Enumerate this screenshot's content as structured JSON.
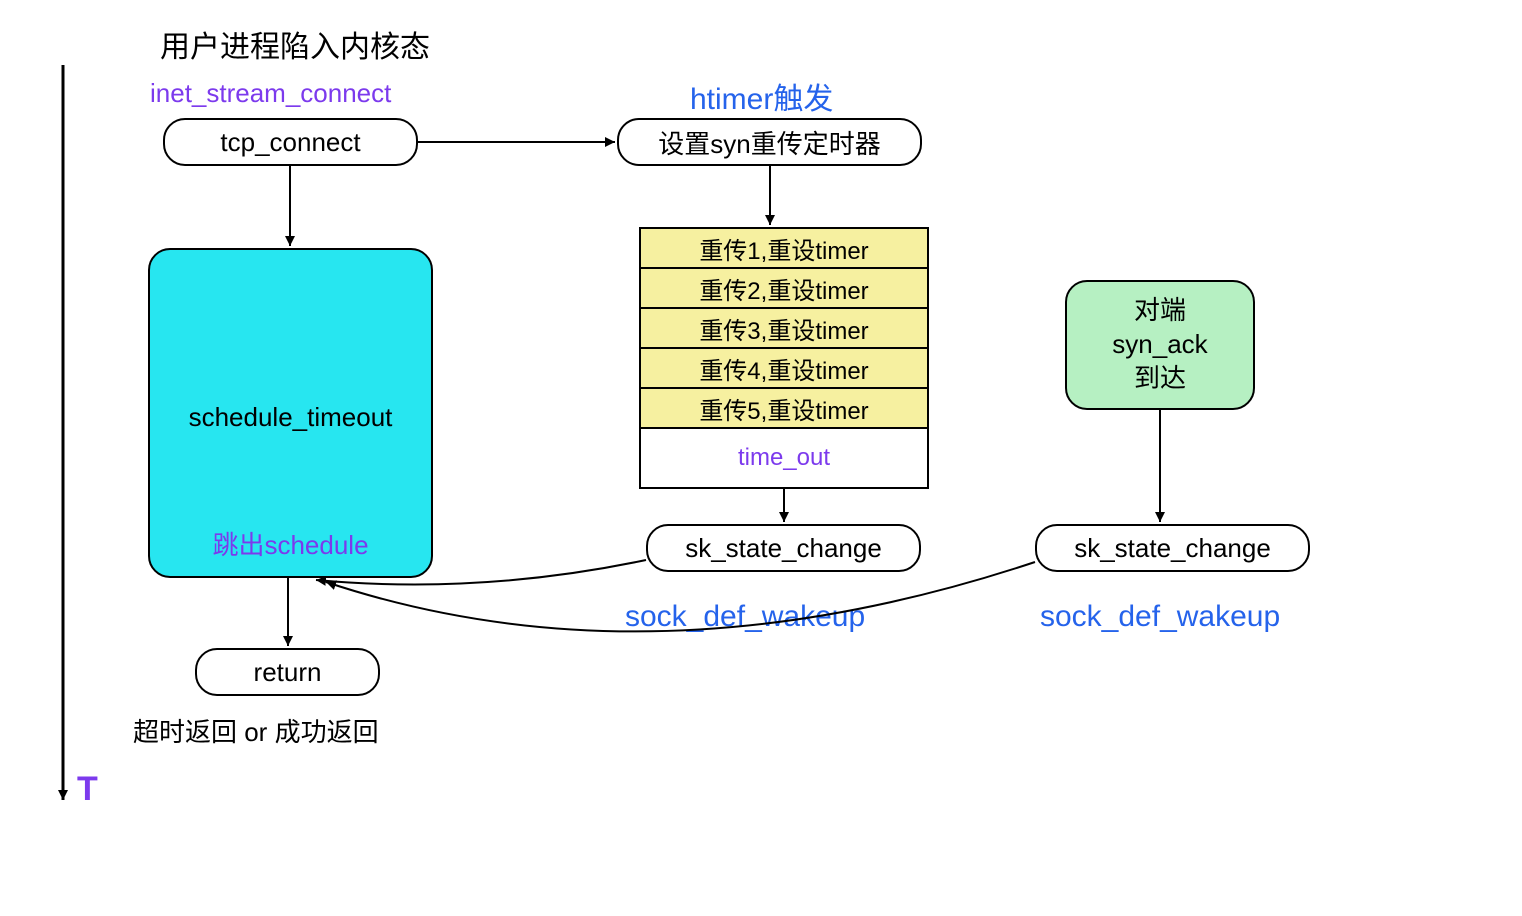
{
  "title": "用户进程陷入内核态",
  "labels": {
    "inet_stream_connect": "inet_stream_connect",
    "htimer": "htimer触发",
    "sock_def_wakeup_1": "sock_def_wakeup",
    "sock_def_wakeup_2": "sock_def_wakeup",
    "return_note": "超时返回 or 成功返回",
    "time_axis": "T",
    "jump_out_schedule": "跳出schedule"
  },
  "nodes": {
    "tcp_connect": "tcp_connect",
    "set_syn_timer": "设置syn重传定时器",
    "schedule_timeout": "schedule_timeout",
    "sk_state_change_1": "sk_state_change",
    "sk_state_change_2": "sk_state_change",
    "return": "return",
    "peer_syn_ack": {
      "l1": "对端",
      "l2": "syn_ack",
      "l3": "到达"
    }
  },
  "table": {
    "rows": [
      "重传1,重设timer",
      "重传2,重设timer",
      "重传3,重设timer",
      "重传4,重设timer",
      "重传5,重设timer"
    ],
    "timeout": "time_out"
  }
}
